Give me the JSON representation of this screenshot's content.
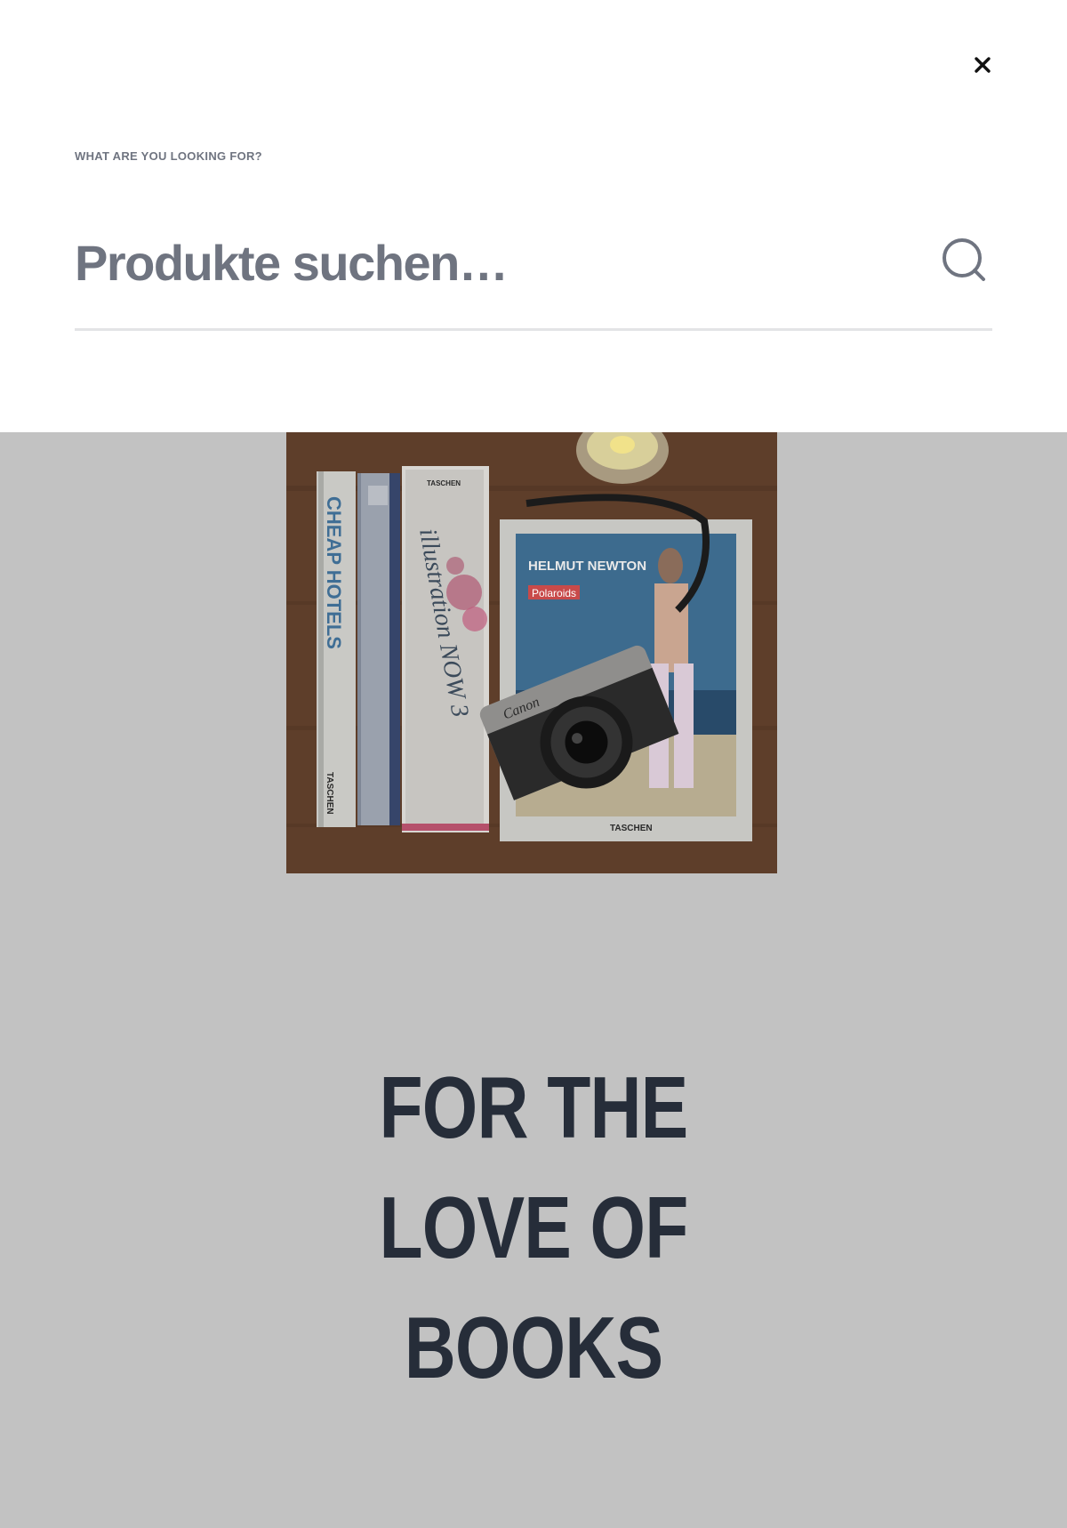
{
  "search": {
    "label": "WHAT ARE YOU LOOKING FOR?",
    "placeholder": "Produkte suchen…",
    "value": ""
  },
  "icons": {
    "close": "close-icon",
    "search": "search-icon"
  },
  "hero": {
    "image_texts": {
      "book1_title": "CHEAP HOTELS",
      "book1_publisher": "TASCHEN",
      "book3_title": "illustration NOW 3",
      "book3_publisher": "TASCHEN",
      "book4_title": "HELMUT NEWTON",
      "book4_subtitle": "Polaroids",
      "book4_publisher": "TASCHEN",
      "camera_brand": "Canon"
    },
    "heading_lines": [
      "FOR THE",
      "LOVE OF",
      "BOOKS"
    ]
  },
  "colors": {
    "overlay_bg": "#ffffff",
    "page_dim": "#c2c2c2",
    "heading": "#262d39",
    "muted_text": "#6f7480",
    "divider": "#e3e4e6"
  }
}
